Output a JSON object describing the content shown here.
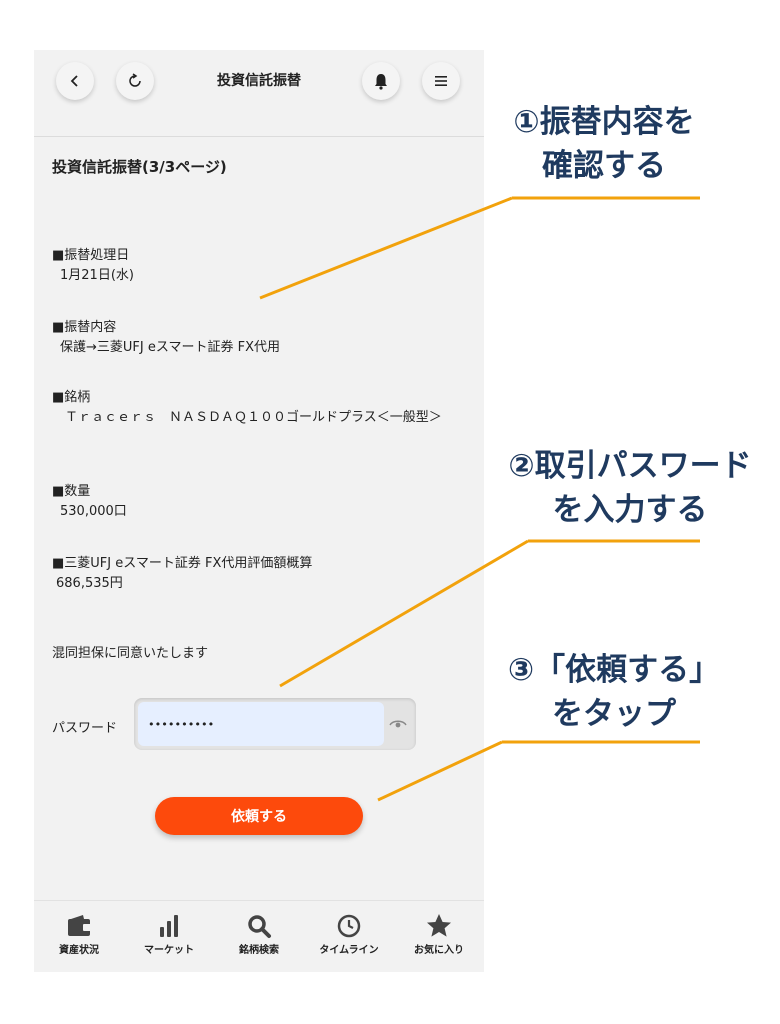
{
  "header": {
    "title": "投資信託振替",
    "back_icon": "chevron-left-icon",
    "refresh_icon": "refresh-icon",
    "bell_icon": "bell-icon",
    "menu_icon": "hamburger-menu-icon"
  },
  "page_title": "投資信託振替(3/3ページ)",
  "sections": [
    {
      "label": "■振替処理日",
      "value": "1月21日(水)"
    },
    {
      "label": "■振替内容",
      "value": "保護→三菱UFJ eスマート証券 FX代用"
    },
    {
      "label": "■銘柄",
      "value": "　Ｔｒａｃｅｒｓ　ＮＡＳＤＡＱ１００ゴールドプラス＜一般型＞"
    },
    {
      "label": "■数量",
      "value": "530,000口"
    },
    {
      "label": "■三菱UFJ eスマート証券 FX代用評価額概算",
      "value": "686,535円"
    }
  ],
  "consent_text": "混同担保に同意いたします",
  "password": {
    "label": "パスワード",
    "value": "••••••••••",
    "toggle_icon": "eye-icon"
  },
  "submit_label": "依頼する",
  "tabbar": [
    {
      "label": "資産状況",
      "icon": "wallet-icon"
    },
    {
      "label": "マーケット",
      "icon": "bar-chart-icon"
    },
    {
      "label": "銘柄検索",
      "icon": "search-icon"
    },
    {
      "label": "タイムライン",
      "icon": "clock-icon"
    },
    {
      "label": "お気に入り",
      "icon": "star-icon"
    }
  ],
  "annotations": [
    {
      "line1": "①振替内容を",
      "line2": "確認する"
    },
    {
      "line1": "②取引パスワード",
      "line2": "を入力する"
    },
    {
      "line1": "③「依頼する」",
      "line2": "をタップ"
    }
  ],
  "colors": {
    "accent": "#fd4a0c",
    "annotation_text": "#1f3a5f",
    "annotation_line": "#f2a20c",
    "input_bg": "#e6efff"
  }
}
